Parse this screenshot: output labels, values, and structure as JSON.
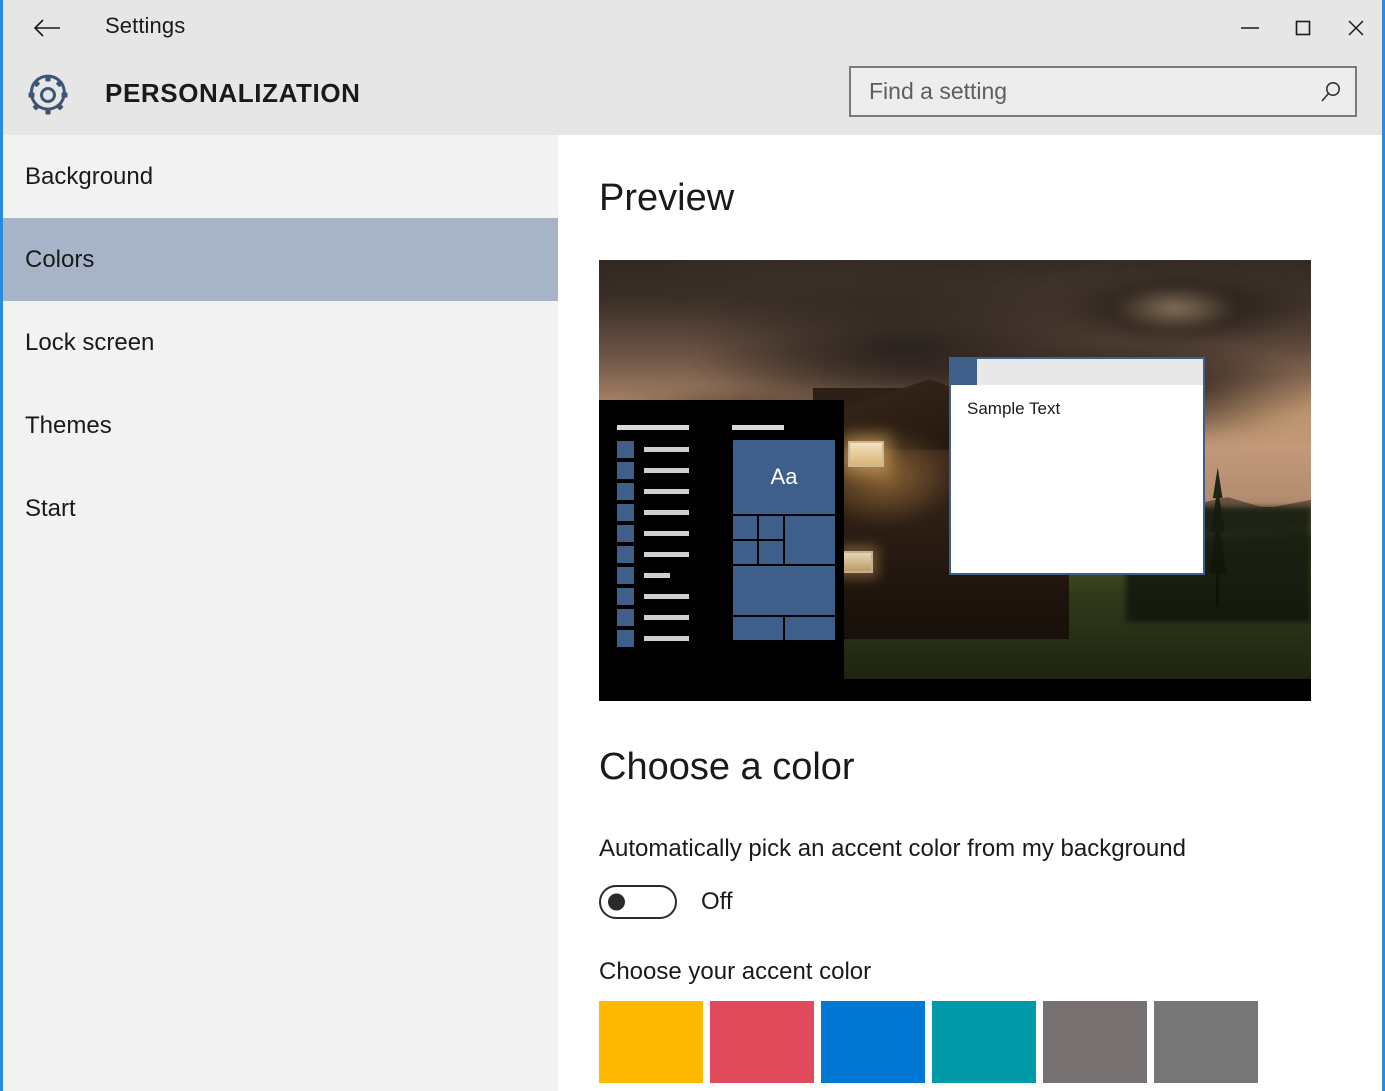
{
  "window": {
    "title": "Settings",
    "back_label": "Back",
    "minimize_label": "Minimize",
    "maximize_label": "Maximize",
    "close_label": "Close",
    "border_color": "#2a8ae0"
  },
  "header": {
    "page_title": "PERSONALIZATION",
    "gear_icon": "gear-icon",
    "gear_color": "#3d5675"
  },
  "search": {
    "placeholder": "Find a setting",
    "value": "",
    "icon": "search-icon"
  },
  "sidebar": {
    "items": [
      {
        "label": "Background",
        "selected": false
      },
      {
        "label": "Colors",
        "selected": true
      },
      {
        "label": "Lock screen",
        "selected": false
      },
      {
        "label": "Themes",
        "selected": false
      },
      {
        "label": "Start",
        "selected": false
      }
    ],
    "selected_bg": "#a7b4c8",
    "bg": "#f2f2f2"
  },
  "main": {
    "preview_heading": "Preview",
    "choose_color_heading": "Choose a color",
    "auto_accent_label": "Automatically pick an accent color from my background",
    "toggle_state": "Off",
    "toggle_on": false,
    "accent_label": "Choose your accent color"
  },
  "preview": {
    "sample_window_text": "Sample Text",
    "tile_letters": "Aa",
    "accent_color": "#3d5f8a",
    "taskbar_color": "#000000",
    "start_menu_color": "#000000",
    "tile_rows": 10
  },
  "accent_swatches": [
    {
      "name": "gold",
      "color": "#ffb900"
    },
    {
      "name": "red",
      "color": "#e04a5a"
    },
    {
      "name": "blue",
      "color": "#0078d4"
    },
    {
      "name": "teal",
      "color": "#0099a8"
    },
    {
      "name": "dark-gray",
      "color": "#767070"
    },
    {
      "name": "gray",
      "color": "#767676"
    }
  ]
}
